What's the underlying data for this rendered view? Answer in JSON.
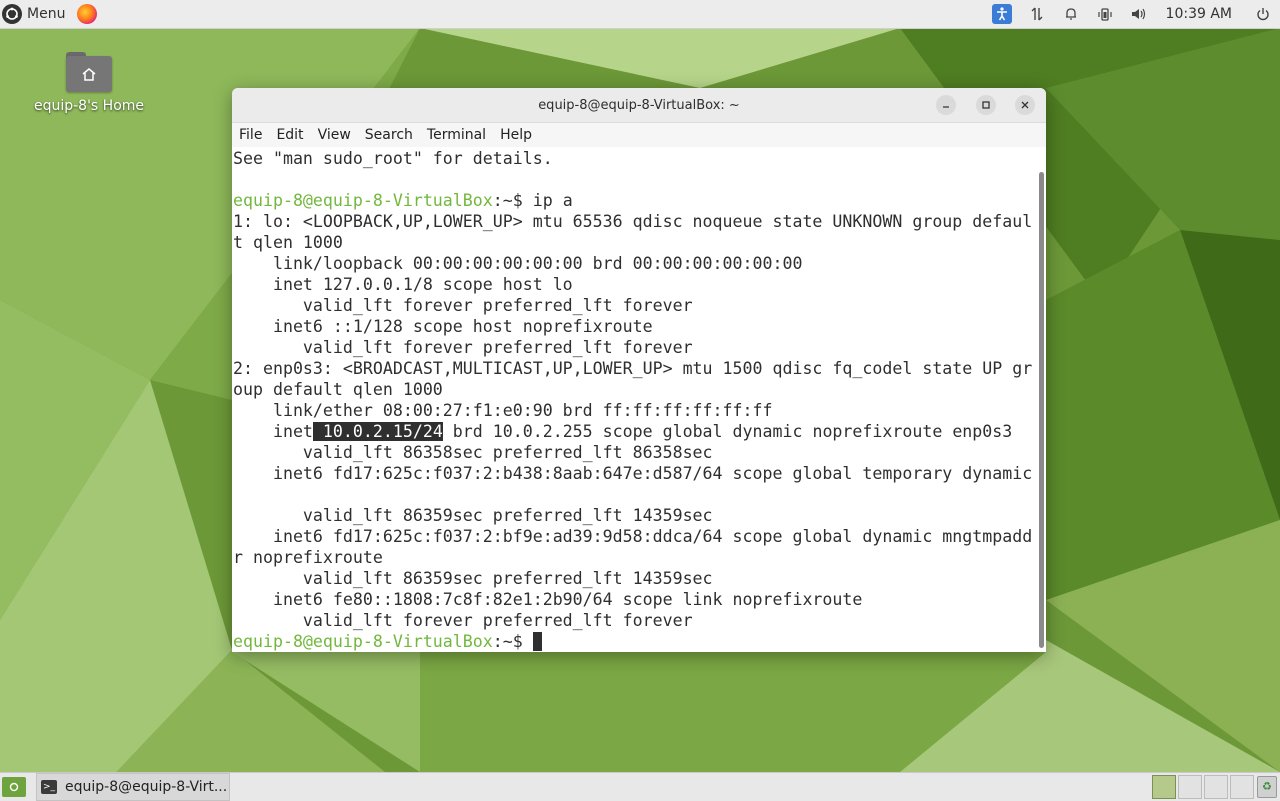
{
  "top_panel": {
    "menu_label": "Menu",
    "clock": "10:39 AM",
    "tray_icons": [
      "accessibility-icon",
      "network-icon",
      "notifications-icon",
      "battery-icon",
      "volume-icon",
      "power-icon"
    ]
  },
  "desktop": {
    "home_icon_label": "equip-8's Home"
  },
  "terminal": {
    "title": "equip-8@equip-8-VirtualBox: ~",
    "menu": [
      "File",
      "Edit",
      "View",
      "Search",
      "Terminal",
      "Help"
    ],
    "prompt_user": "equip-8@equip-8-VirtualBox",
    "prompt_suffix": ":~$",
    "lines": {
      "l0": "See \"man sudo_root\" for details.",
      "cmd": " ip a",
      "l2": "1: lo: <LOOPBACK,UP,LOWER_UP> mtu 65536 qdisc noqueue state UNKNOWN group defaul",
      "l3": "t qlen 1000",
      "l4": "    link/loopback 00:00:00:00:00:00 brd 00:00:00:00:00:00",
      "l5": "    inet 127.0.0.1/8 scope host lo",
      "l6": "       valid_lft forever preferred_lft forever",
      "l7": "    inet6 ::1/128 scope host noprefixroute",
      "l8": "       valid_lft forever preferred_lft forever",
      "l9": "2: enp0s3: <BROADCAST,MULTICAST,UP,LOWER_UP> mtu 1500 qdisc fq_codel state UP gr",
      "l10": "oup default qlen 1000",
      "l11": "    link/ether 08:00:27:f1:e0:90 brd ff:ff:ff:ff:ff:ff",
      "l12a": "    inet",
      "l12sel": " 10.0.2.15/24",
      "l12b": " brd 10.0.2.255 scope global dynamic noprefixroute enp0s3",
      "l13": "       valid_lft 86358sec preferred_lft 86358sec",
      "l14": "    inet6 fd17:625c:f037:2:b438:8aab:647e:d587/64 scope global temporary dynamic",
      "l15": "",
      "l16": "       valid_lft 86359sec preferred_lft 14359sec",
      "l17": "    inet6 fd17:625c:f037:2:bf9e:ad39:9d58:ddca/64 scope global dynamic mngtmpadd",
      "l18": "r noprefixroute",
      "l19": "       valid_lft 86359sec preferred_lft 14359sec",
      "l20": "    inet6 fe80::1808:7c8f:82e1:2b90/64 scope link noprefixroute",
      "l21": "       valid_lft forever preferred_lft forever"
    }
  },
  "taskbar": {
    "task_label": "equip-8@equip-8-Virt..."
  },
  "colors": {
    "prompt_green": "#72b83d",
    "wallpaper_green": "#6f9b3a",
    "accessibility_blue": "#3b7cd6"
  }
}
